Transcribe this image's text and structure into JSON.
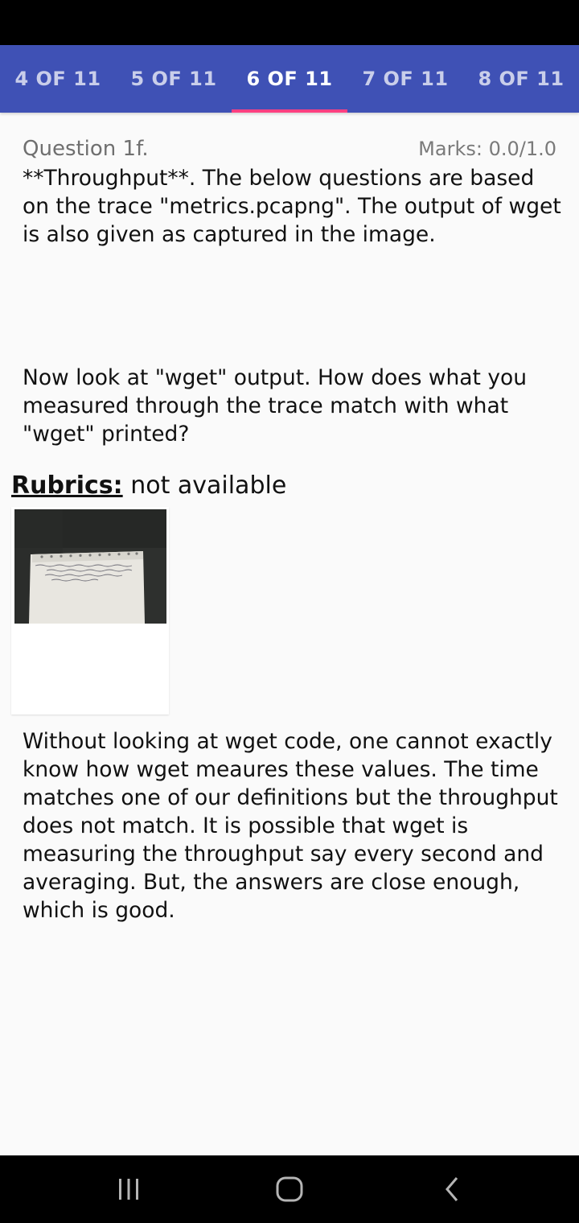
{
  "tabs": [
    {
      "label": "4 OF 11",
      "active": false
    },
    {
      "label": "5 OF 11",
      "active": false
    },
    {
      "label": "6 OF 11",
      "active": true
    },
    {
      "label": "7 OF 11",
      "active": false
    },
    {
      "label": "8 OF 11",
      "active": false
    }
  ],
  "question": {
    "title": "Question 1f.",
    "marks": "Marks: 0.0/1.0",
    "text_1": "**Throughput**. The below questions are based on the trace \"metrics.pcapng\". The output of wget is also given as captured in the image.",
    "text_2": "Now look at \"wget\" output. How does what you measured through the trace match with what \"wget\" printed?"
  },
  "rubrics": {
    "label": "Rubrics:",
    "value": "not available"
  },
  "attachment": {
    "icon": "handwritten-note-photo-thumbnail"
  },
  "answer": {
    "text": "Without looking at wget code, one cannot exactly know how wget meaures these values. The time matches one of our definitions but the throughput does not match. It is possible that wget is measuring the throughput say every second and averaging. But, the answers are close enough, which is good."
  },
  "nav": {
    "recent_icon": "recent-apps-icon",
    "home_icon": "home-icon",
    "back_icon": "back-icon"
  },
  "colors": {
    "tab_bar": "#3f51b5",
    "tab_indicator": "#ff4081",
    "background": "#fafafa"
  }
}
